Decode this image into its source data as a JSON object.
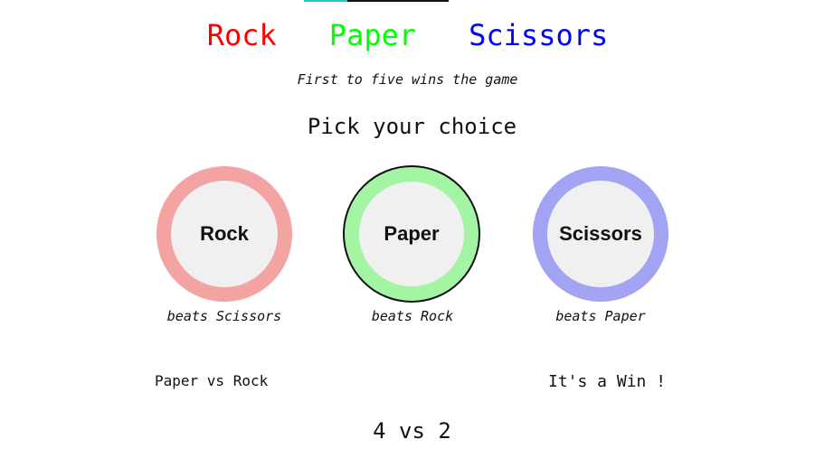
{
  "header": {
    "title_words": [
      "Rock",
      "Paper",
      "Scissors"
    ],
    "subtitle": "First to five wins the game"
  },
  "prompt": "Pick your choice",
  "choices": [
    {
      "label": "Rock",
      "beats": "beats Scissors",
      "ring_color": "#f4a3a3"
    },
    {
      "label": "Paper",
      "beats": "beats Rock",
      "ring_color": "#a3f4a3",
      "selected": true
    },
    {
      "label": "Scissors",
      "beats": "beats Paper",
      "ring_color": "#a3a3f4"
    }
  ],
  "round": {
    "matchup": "Paper vs Rock",
    "result": "It's a Win !"
  },
  "score": {
    "display": "4 vs 2",
    "player": 4,
    "computer": 2
  },
  "colors": {
    "rock": "#ff0000",
    "paper": "#00ff00",
    "scissors": "#0000ff"
  }
}
